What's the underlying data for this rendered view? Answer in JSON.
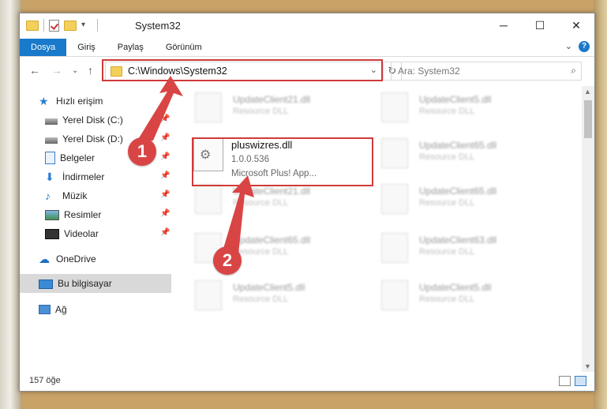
{
  "window": {
    "title": "System32"
  },
  "ribbon": {
    "tabs": [
      "Dosya",
      "Giriş",
      "Paylaş",
      "Görünüm"
    ]
  },
  "address": {
    "path": "C:\\Windows\\System32"
  },
  "search": {
    "placeholder": "Ara: System32"
  },
  "sidebar": {
    "items": [
      {
        "label": "Hızlı erişim",
        "icon": "star-icon"
      },
      {
        "label": "Yerel Disk (C:)",
        "icon": "drive-icon",
        "pinned": true
      },
      {
        "label": "Yerel Disk (D:)",
        "icon": "drive-icon",
        "pinned": true
      },
      {
        "label": "Belgeler",
        "icon": "documents-icon",
        "pinned": true
      },
      {
        "label": "İndirmeler",
        "icon": "download-icon",
        "pinned": true
      },
      {
        "label": "Müzik",
        "icon": "music-icon",
        "pinned": true
      },
      {
        "label": "Resimler",
        "icon": "pictures-icon",
        "pinned": true
      },
      {
        "label": "Videolar",
        "icon": "video-icon",
        "pinned": true
      },
      {
        "label": "OneDrive",
        "icon": "cloud-icon"
      },
      {
        "label": "Bu bilgisayar",
        "icon": "computer-icon",
        "selected": true
      },
      {
        "label": "Ağ",
        "icon": "network-icon"
      }
    ]
  },
  "files": {
    "highlighted": {
      "name": "pluswizres.dll",
      "version": "1.0.0.536",
      "description": "Microsoft Plus! App..."
    },
    "background": [
      {
        "name": "UpdateClient21.dll",
        "type": "Resource DLL"
      },
      {
        "name": "UpdateClient5.dll",
        "type": "Resource DLL"
      },
      {
        "name": "UpdateClient65.dll",
        "type": "Resource DLL"
      },
      {
        "name": "UpdateClient21.dll",
        "type": "Resource DLL"
      },
      {
        "name": "UpdateClient65.dll",
        "type": "Resource DLL"
      },
      {
        "name": "UpdateClient65.dll",
        "type": "Resource DLL"
      },
      {
        "name": "UpdateClient63.dll",
        "type": "Resource DLL"
      },
      {
        "name": "UpdateClient5.dll",
        "type": "Resource DLL"
      },
      {
        "name": "UpdateClient5.dll",
        "type": "Resource DLL"
      }
    ]
  },
  "status": {
    "count": "157 öğe"
  },
  "callouts": {
    "step1": "1",
    "step2": "2"
  },
  "colors": {
    "accent": "#1979ca",
    "callout": "#d94545"
  }
}
